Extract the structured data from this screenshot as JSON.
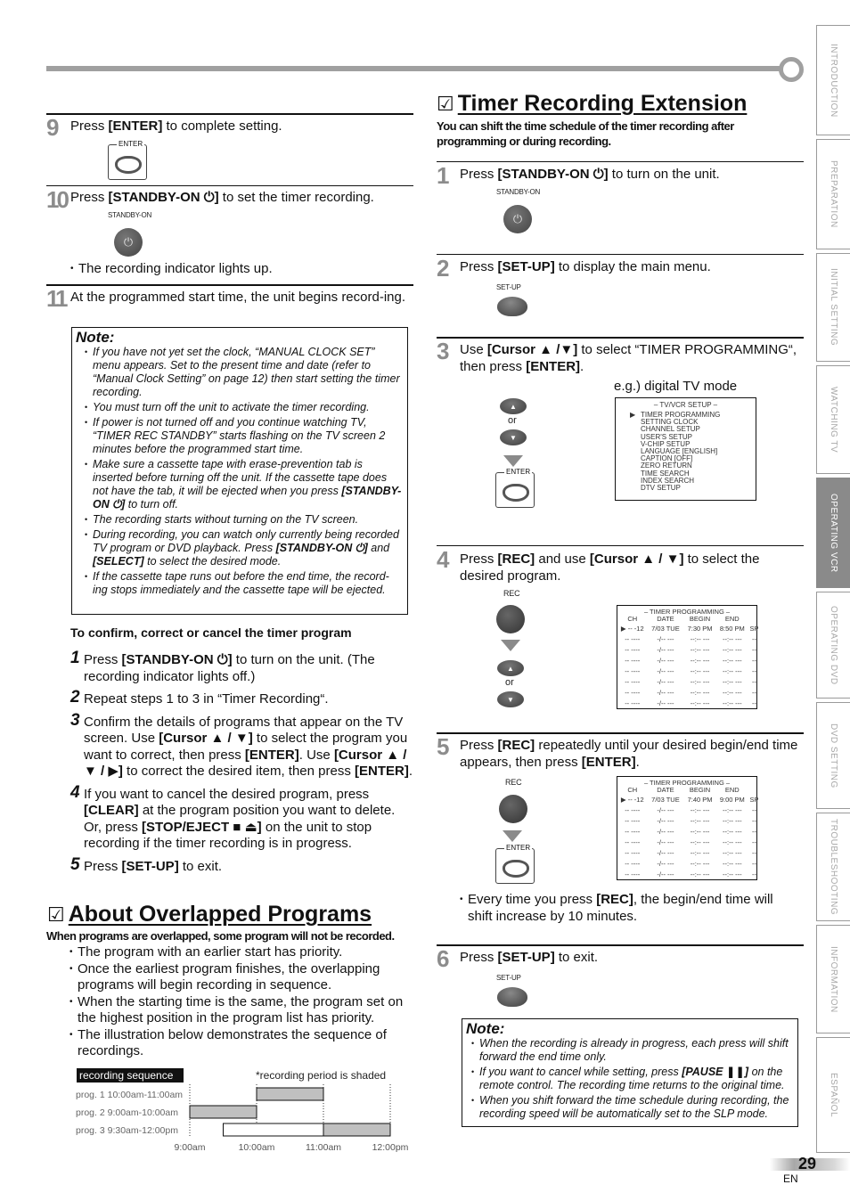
{
  "side_tabs": [
    {
      "label": "INTRODUCTION",
      "active": false
    },
    {
      "label": "PREPARATION",
      "active": false
    },
    {
      "label": "INITIAL  SETTING",
      "active": false
    },
    {
      "label": "WATCHING  TV",
      "active": false
    },
    {
      "label": "OPERATING  VCR",
      "active": true
    },
    {
      "label": "OPERATING  DVD",
      "active": false
    },
    {
      "label": "DVD  SETTING",
      "active": false
    },
    {
      "label": "TROUBLESHOOTING",
      "active": false
    },
    {
      "label": "INFORMATION",
      "active": false
    },
    {
      "label": "ESPAÑOL",
      "active": false
    }
  ],
  "left": {
    "step9": {
      "num": "9",
      "pre": "Press ",
      "key": "[ENTER]",
      "post": " to complete setting.",
      "button_label": "ENTER"
    },
    "step10": {
      "num": "10",
      "pre": "Press ",
      "key": "[STANDBY-ON ⏻]",
      "post": " to set the timer recording.",
      "button_label": "STANDBY-ON",
      "bullet": "The recording indicator lights up."
    },
    "step11": {
      "num": "11",
      "text": "At the programmed start time, the unit begins record-ing."
    },
    "note": {
      "title": "Note:",
      "items": [
        "If you have not yet set the clock, “MANUAL CLOCK SET” menu appears. Set to the present time and date (refer to “Manual Clock Setting” on page 12) then start setting the timer recording.",
        "You must turn off the unit to activate the timer recording.",
        "If power is not turned off and you continue watching TV, “TIMER REC STANDBY” starts flashing on the TV screen 2 minutes before the programmed start time.",
        "Make sure a cassette tape with erase-prevention tab is inserted before turning off the unit. If the cassette tape does not have the tab, it will be ejected when you press [STANDBY-ON ⏻] to turn off.",
        "The recording starts without turning on the TV screen.",
        "During recording, you can watch only currently being recorded TV program or DVD playback. Press [STANDBY-ON ⏻] and [SELECT] to select the desired mode.",
        "If the cassette tape runs out before the end time, the record-ing stops immediately and the cassette tape will be ejected."
      ]
    },
    "confirm": {
      "heading": "To confirm, correct or cancel the timer program",
      "steps": [
        {
          "n": "1",
          "text": "Press [STANDBY-ON ⏻] to turn on the unit. (The recording indicator lights off.)"
        },
        {
          "n": "2",
          "text": "Repeat steps 1 to 3 in “Timer Recording“."
        },
        {
          "n": "3",
          "text": "Confirm the details of programs that appear on the TV screen. Use [Cursor ▲ / ▼] to select the program you want to correct, then press [ENTER]. Use [Cursor ▲ / ▼ / ▶] to correct the desired item, then press [ENTER]."
        },
        {
          "n": "4",
          "text": "If you want to cancel the desired program, press [CLEAR] at the program position you want to delete. Or, press [STOP/EJECT ■ ⏏] on the unit to stop recording if the timer recording is in progress."
        },
        {
          "n": "5",
          "text": "Press [SET-UP] to exit."
        }
      ]
    },
    "overlap": {
      "check": "☑",
      "title": "About Overlapped Programs",
      "subtitle": "When programs are overlapped, some program will not be recorded.",
      "bullets": [
        "The program with an earlier start has priority.",
        "Once the earliest program finishes, the overlapping programs will begin recording in sequence.",
        "When the starting time is the same, the program set on the highest position in the program list has priority.",
        "The illustration below demonstrates the sequence of recordings."
      ]
    }
  },
  "chart_data": {
    "type": "bar",
    "subtype": "gantt",
    "title": "recording sequence",
    "annotation": "*recording period is shaded",
    "x_ticks": [
      "9:00am",
      "10:00am",
      "11:00am",
      "12:00pm"
    ],
    "x_range_hours": [
      9,
      12
    ],
    "rows": [
      {
        "label": "prog. 1 10:00am-11:00am",
        "program_start": 10,
        "program_end": 11,
        "recorded_start": 10,
        "recorded_end": 11
      },
      {
        "label": "prog. 2   9:00am-10:00am",
        "program_start": 9,
        "program_end": 10,
        "recorded_start": 9,
        "recorded_end": 10
      },
      {
        "label": "prog. 3   9:30am-12:00pm",
        "program_start": 9.5,
        "program_end": 12,
        "recorded_start": 11,
        "recorded_end": 12
      }
    ],
    "colors": {
      "shaded": "#c0c0c0",
      "unshaded": "#ffffff"
    }
  },
  "right": {
    "header": {
      "check": "☑",
      "title": "Timer Recording Extension",
      "subtitle": "You can shift the time schedule of the timer recording after programming or during recording."
    },
    "step1": {
      "num": "1",
      "pre": "Press ",
      "key": "[STANDBY-ON ⏻]",
      "post": " to turn on the unit.",
      "button_label": "STANDBY-ON"
    },
    "step2": {
      "num": "2",
      "pre": "Press ",
      "key": "[SET-UP]",
      "post": " to display the main menu.",
      "button_label": "SET-UP"
    },
    "step3": {
      "num": "3",
      "text_a": "Use ",
      "key_a": "[Cursor ▲ /▼]",
      "text_b": " to select “TIMER PROGRAMMING“, then press ",
      "key_b": "[ENTER]",
      "text_c": ".",
      "caption": "e.g.) digital TV mode",
      "or": "or",
      "enter_label": "ENTER"
    },
    "menu": {
      "title": "– TV/VCR SETUP –",
      "cursor": "▶",
      "items": [
        "TIMER PROGRAMMING",
        "SETTING CLOCK",
        "CHANNEL SETUP",
        "USER'S SETUP",
        "V-CHIP SETUP",
        "LANGUAGE  [ENGLISH]",
        "CAPTION  [OFF]",
        "ZERO RETURN",
        "TIME SEARCH",
        "INDEX SEARCH",
        "DTV SETUP"
      ]
    },
    "step4": {
      "num": "4",
      "pre": "Press ",
      "key_a": "[REC]",
      "mid": " and use ",
      "key_b": "[Cursor ▲ / ▼]",
      "post": " to select the desired program.",
      "rec_label": "REC",
      "or": "or"
    },
    "step5": {
      "num": "5",
      "pre": "Press ",
      "key_a": "[REC]",
      "mid": " repeatedly until your desired begin/end time appears, then press ",
      "key_b": "[ENTER]",
      "post": ".",
      "rec_label": "REC",
      "enter_label": "ENTER",
      "bullet_pre": "Every time you press ",
      "bullet_key": "[REC]",
      "bullet_post": ", the begin/end time will shift increase by 10 minutes."
    },
    "timer_screens": [
      {
        "title": "– TIMER PROGRAMMING –",
        "headers": [
          "",
          "CH",
          "DATE",
          "BEGIN",
          "END",
          ""
        ],
        "first_row": [
          "▶ -- -12",
          "7/03 TUE",
          "7:30 PM",
          "8:50 PM",
          "SP"
        ],
        "empty_row": [
          "-- ----",
          "-/-- ---",
          "--:-- ---",
          "--:-- ---",
          "--"
        ],
        "empty_rows": 7
      },
      {
        "title": "– TIMER PROGRAMMING –",
        "headers": [
          "",
          "CH",
          "DATE",
          "BEGIN",
          "END",
          ""
        ],
        "first_row": [
          "▶ -- -12",
          "7/03 TUE",
          "7:40 PM",
          "9:00 PM",
          "SP"
        ],
        "empty_row": [
          "-- ----",
          "-/-- ---",
          "--:-- ---",
          "--:-- ---",
          "--"
        ],
        "empty_rows": 7
      }
    ],
    "step6": {
      "num": "6",
      "pre": "Press ",
      "key": "[SET-UP]",
      "post": " to exit.",
      "button_label": "SET-UP"
    },
    "note": {
      "title": "Note:",
      "items": [
        "When the recording is already in progress, each press will shift forward the end time only.",
        "If you want to cancel while setting, press [PAUSE ❚❚] on the remote control. The recording time returns to the original time.",
        "When you shift forward the time schedule during recording, the recording speed will be automatically set to the SLP mode."
      ]
    }
  },
  "footer": {
    "page_number": "29",
    "lang": "EN"
  }
}
